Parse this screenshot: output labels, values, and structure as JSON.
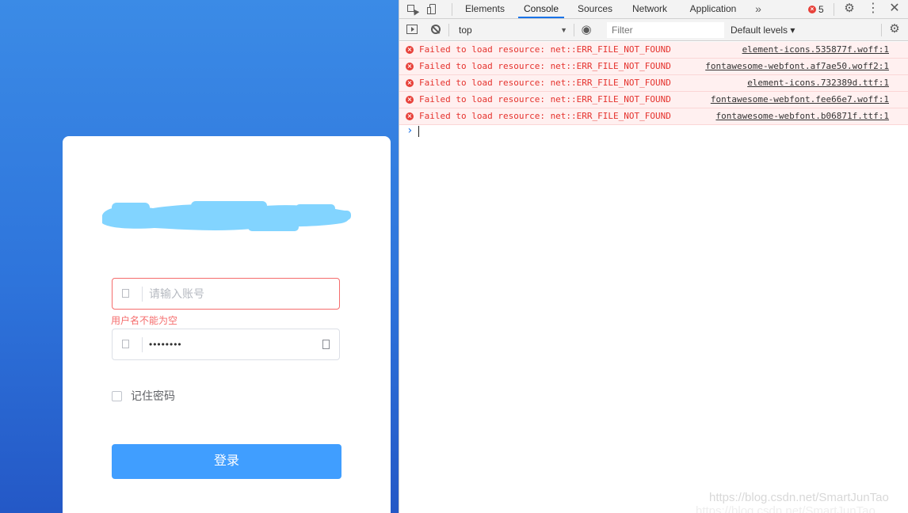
{
  "login": {
    "username_placeholder": "请输入账号",
    "username_error": "用户名不能为空",
    "password_value": "••••••••",
    "remember_label": "记住密码",
    "login_button": "登录",
    "colors": {
      "background_top": "#3b8be6",
      "background_bottom": "#2458c6",
      "button": "#409eff",
      "error": "#f56c6c",
      "redaction": "#82d4ff"
    }
  },
  "devtools": {
    "tabs": [
      "Elements",
      "Console",
      "Sources",
      "Network",
      "Application"
    ],
    "active_tab": "Console",
    "more_tabs_label": "»",
    "error_count": "5",
    "context": "top",
    "filter_placeholder": "Filter",
    "levels": "Default levels ▾",
    "messages": [
      {
        "text": "Failed to load resource: net::ERR_FILE_NOT_FOUND",
        "source": "element-icons.535877f.woff:1"
      },
      {
        "text": "Failed to load resource: net::ERR_FILE_NOT_FOUND",
        "source": "fontawesome-webfont.af7ae50.woff2:1"
      },
      {
        "text": "Failed to load resource: net::ERR_FILE_NOT_FOUND",
        "source": "element-icons.732389d.ttf:1"
      },
      {
        "text": "Failed to load resource: net::ERR_FILE_NOT_FOUND",
        "source": "fontawesome-webfont.fee66e7.woff:1"
      },
      {
        "text": "Failed to load resource: net::ERR_FILE_NOT_FOUND",
        "source": "fontawesome-webfont.b06871f.ttf:1"
      }
    ],
    "prompt_symbol": "›",
    "icons": {
      "inspect": "inspect-element-icon",
      "device": "device-toolbar-icon",
      "settings": "gear-icon",
      "menu": "kebab-menu-icon",
      "close": "close-icon",
      "sidebar": "sidebar-toggle-icon",
      "clear": "clear-console-icon",
      "live_expression": "eye-icon",
      "error": "error-icon"
    },
    "colors": {
      "error_text": "#e5322d",
      "error_bg": "#fff0f0",
      "active_tab_underline": "#1a73e8"
    }
  },
  "watermark": "https://blog.csdn.net/SmartJunTao"
}
